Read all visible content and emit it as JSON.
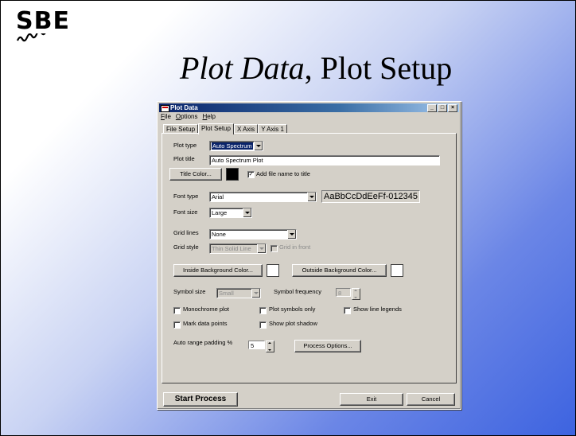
{
  "slide": {
    "logo_text": "SBE",
    "title_italic": "Plot Data",
    "title_rest": ", Plot Setup"
  },
  "window": {
    "title": "Plot Data",
    "controls": {
      "minimize": "_",
      "maximize": "□",
      "close": "×"
    },
    "menu": [
      "File",
      "Options",
      "Help"
    ],
    "tabs": [
      "File Setup",
      "Plot Setup",
      "X Axis",
      "Y Axis 1"
    ],
    "active_tab": "Plot Setup"
  },
  "form": {
    "plot_type_label": "Plot type",
    "plot_type_value": "Auto Spectrum",
    "plot_title_label": "Plot title",
    "plot_title_value": "Auto Spectrum Plot",
    "title_color_button": "Title Color...",
    "title_color": "#000000",
    "add_file_name_label": "Add file name to title",
    "add_file_name_checked": true,
    "font_type_label": "Font type",
    "font_type_value": "Arial",
    "font_preview": "AaBbCcDdEeFf-012345",
    "font_size_label": "Font size",
    "font_size_value": "Large",
    "grid_lines_label": "Grid lines",
    "grid_lines_value": "None",
    "grid_style_label": "Grid style",
    "grid_style_value": "Thin Solid Line",
    "grid_in_front_label": "Grid in front",
    "inside_bg_button": "Inside Background Color...",
    "inside_bg_color": "#ffffff",
    "outside_bg_button": "Outside Background Color...",
    "outside_bg_color": "#ffffff",
    "symbol_size_label": "Symbol size",
    "symbol_size_value": "Small",
    "symbol_frequency_label": "Symbol frequency",
    "symbol_frequency_value": "8",
    "monochrome_label": "Monochrome plot",
    "plot_symbols_only_label": "Plot symbols only",
    "show_line_legends_label": "Show line legends",
    "mark_data_points_label": "Mark data points",
    "show_plot_shadow_label": "Show plot shadow",
    "auto_range_label": "Auto range padding %",
    "auto_range_value": "5",
    "process_options_button": "Process Options..."
  },
  "footer": {
    "start_process": "Start Process",
    "exit": "Exit",
    "cancel": "Cancel"
  }
}
